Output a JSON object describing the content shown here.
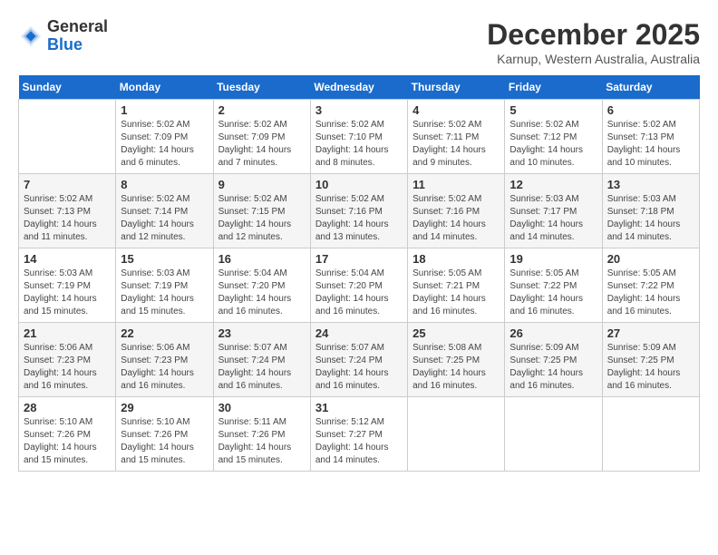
{
  "header": {
    "logo": {
      "general": "General",
      "blue": "Blue"
    },
    "title": "December 2025",
    "location": "Karnup, Western Australia, Australia"
  },
  "calendar": {
    "days_of_week": [
      "Sunday",
      "Monday",
      "Tuesday",
      "Wednesday",
      "Thursday",
      "Friday",
      "Saturday"
    ],
    "weeks": [
      [
        {
          "day": "",
          "info": ""
        },
        {
          "day": "1",
          "info": "Sunrise: 5:02 AM\nSunset: 7:09 PM\nDaylight: 14 hours\nand 6 minutes."
        },
        {
          "day": "2",
          "info": "Sunrise: 5:02 AM\nSunset: 7:09 PM\nDaylight: 14 hours\nand 7 minutes."
        },
        {
          "day": "3",
          "info": "Sunrise: 5:02 AM\nSunset: 7:10 PM\nDaylight: 14 hours\nand 8 minutes."
        },
        {
          "day": "4",
          "info": "Sunrise: 5:02 AM\nSunset: 7:11 PM\nDaylight: 14 hours\nand 9 minutes."
        },
        {
          "day": "5",
          "info": "Sunrise: 5:02 AM\nSunset: 7:12 PM\nDaylight: 14 hours\nand 10 minutes."
        },
        {
          "day": "6",
          "info": "Sunrise: 5:02 AM\nSunset: 7:13 PM\nDaylight: 14 hours\nand 10 minutes."
        }
      ],
      [
        {
          "day": "7",
          "info": "Sunrise: 5:02 AM\nSunset: 7:13 PM\nDaylight: 14 hours\nand 11 minutes."
        },
        {
          "day": "8",
          "info": "Sunrise: 5:02 AM\nSunset: 7:14 PM\nDaylight: 14 hours\nand 12 minutes."
        },
        {
          "day": "9",
          "info": "Sunrise: 5:02 AM\nSunset: 7:15 PM\nDaylight: 14 hours\nand 12 minutes."
        },
        {
          "day": "10",
          "info": "Sunrise: 5:02 AM\nSunset: 7:16 PM\nDaylight: 14 hours\nand 13 minutes."
        },
        {
          "day": "11",
          "info": "Sunrise: 5:02 AM\nSunset: 7:16 PM\nDaylight: 14 hours\nand 14 minutes."
        },
        {
          "day": "12",
          "info": "Sunrise: 5:03 AM\nSunset: 7:17 PM\nDaylight: 14 hours\nand 14 minutes."
        },
        {
          "day": "13",
          "info": "Sunrise: 5:03 AM\nSunset: 7:18 PM\nDaylight: 14 hours\nand 14 minutes."
        }
      ],
      [
        {
          "day": "14",
          "info": "Sunrise: 5:03 AM\nSunset: 7:19 PM\nDaylight: 14 hours\nand 15 minutes."
        },
        {
          "day": "15",
          "info": "Sunrise: 5:03 AM\nSunset: 7:19 PM\nDaylight: 14 hours\nand 15 minutes."
        },
        {
          "day": "16",
          "info": "Sunrise: 5:04 AM\nSunset: 7:20 PM\nDaylight: 14 hours\nand 16 minutes."
        },
        {
          "day": "17",
          "info": "Sunrise: 5:04 AM\nSunset: 7:20 PM\nDaylight: 14 hours\nand 16 minutes."
        },
        {
          "day": "18",
          "info": "Sunrise: 5:05 AM\nSunset: 7:21 PM\nDaylight: 14 hours\nand 16 minutes."
        },
        {
          "day": "19",
          "info": "Sunrise: 5:05 AM\nSunset: 7:22 PM\nDaylight: 14 hours\nand 16 minutes."
        },
        {
          "day": "20",
          "info": "Sunrise: 5:05 AM\nSunset: 7:22 PM\nDaylight: 14 hours\nand 16 minutes."
        }
      ],
      [
        {
          "day": "21",
          "info": "Sunrise: 5:06 AM\nSunset: 7:23 PM\nDaylight: 14 hours\nand 16 minutes."
        },
        {
          "day": "22",
          "info": "Sunrise: 5:06 AM\nSunset: 7:23 PM\nDaylight: 14 hours\nand 16 minutes."
        },
        {
          "day": "23",
          "info": "Sunrise: 5:07 AM\nSunset: 7:24 PM\nDaylight: 14 hours\nand 16 minutes."
        },
        {
          "day": "24",
          "info": "Sunrise: 5:07 AM\nSunset: 7:24 PM\nDaylight: 14 hours\nand 16 minutes."
        },
        {
          "day": "25",
          "info": "Sunrise: 5:08 AM\nSunset: 7:25 PM\nDaylight: 14 hours\nand 16 minutes."
        },
        {
          "day": "26",
          "info": "Sunrise: 5:09 AM\nSunset: 7:25 PM\nDaylight: 14 hours\nand 16 minutes."
        },
        {
          "day": "27",
          "info": "Sunrise: 5:09 AM\nSunset: 7:25 PM\nDaylight: 14 hours\nand 16 minutes."
        }
      ],
      [
        {
          "day": "28",
          "info": "Sunrise: 5:10 AM\nSunset: 7:26 PM\nDaylight: 14 hours\nand 15 minutes."
        },
        {
          "day": "29",
          "info": "Sunrise: 5:10 AM\nSunset: 7:26 PM\nDaylight: 14 hours\nand 15 minutes."
        },
        {
          "day": "30",
          "info": "Sunrise: 5:11 AM\nSunset: 7:26 PM\nDaylight: 14 hours\nand 15 minutes."
        },
        {
          "day": "31",
          "info": "Sunrise: 5:12 AM\nSunset: 7:27 PM\nDaylight: 14 hours\nand 14 minutes."
        },
        {
          "day": "",
          "info": ""
        },
        {
          "day": "",
          "info": ""
        },
        {
          "day": "",
          "info": ""
        }
      ]
    ]
  }
}
